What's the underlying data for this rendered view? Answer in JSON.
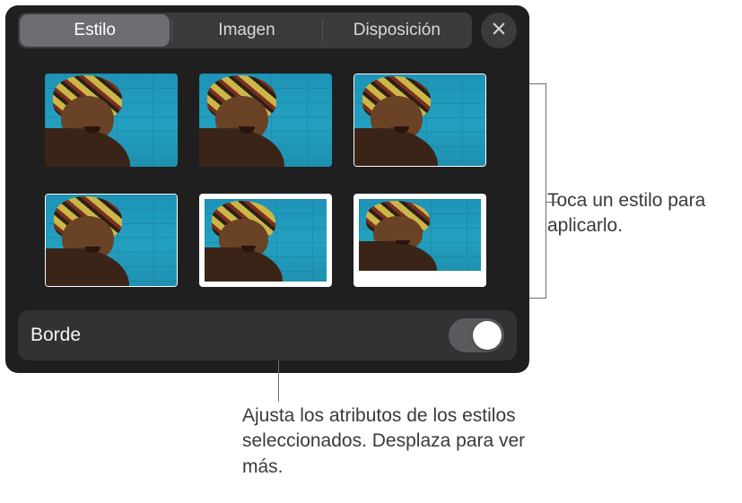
{
  "tabs": {
    "style": "Estilo",
    "image": "Imagen",
    "layout": "Disposición",
    "active": "style"
  },
  "styles_grid": {
    "items": [
      {
        "name": "style-plain"
      },
      {
        "name": "style-reflection"
      },
      {
        "name": "style-thin-outline"
      },
      {
        "name": "style-thin-outline-2"
      },
      {
        "name": "style-thick-white-border"
      },
      {
        "name": "style-photo-frame"
      }
    ]
  },
  "border_row": {
    "label": "Borde",
    "value": false
  },
  "callouts": {
    "right": "Toca un estilo para aplicarlo.",
    "bottom": "Ajusta los atributos de los estilos seleccionados. Desplaza para ver más."
  },
  "icons": {
    "close": "close-icon"
  }
}
